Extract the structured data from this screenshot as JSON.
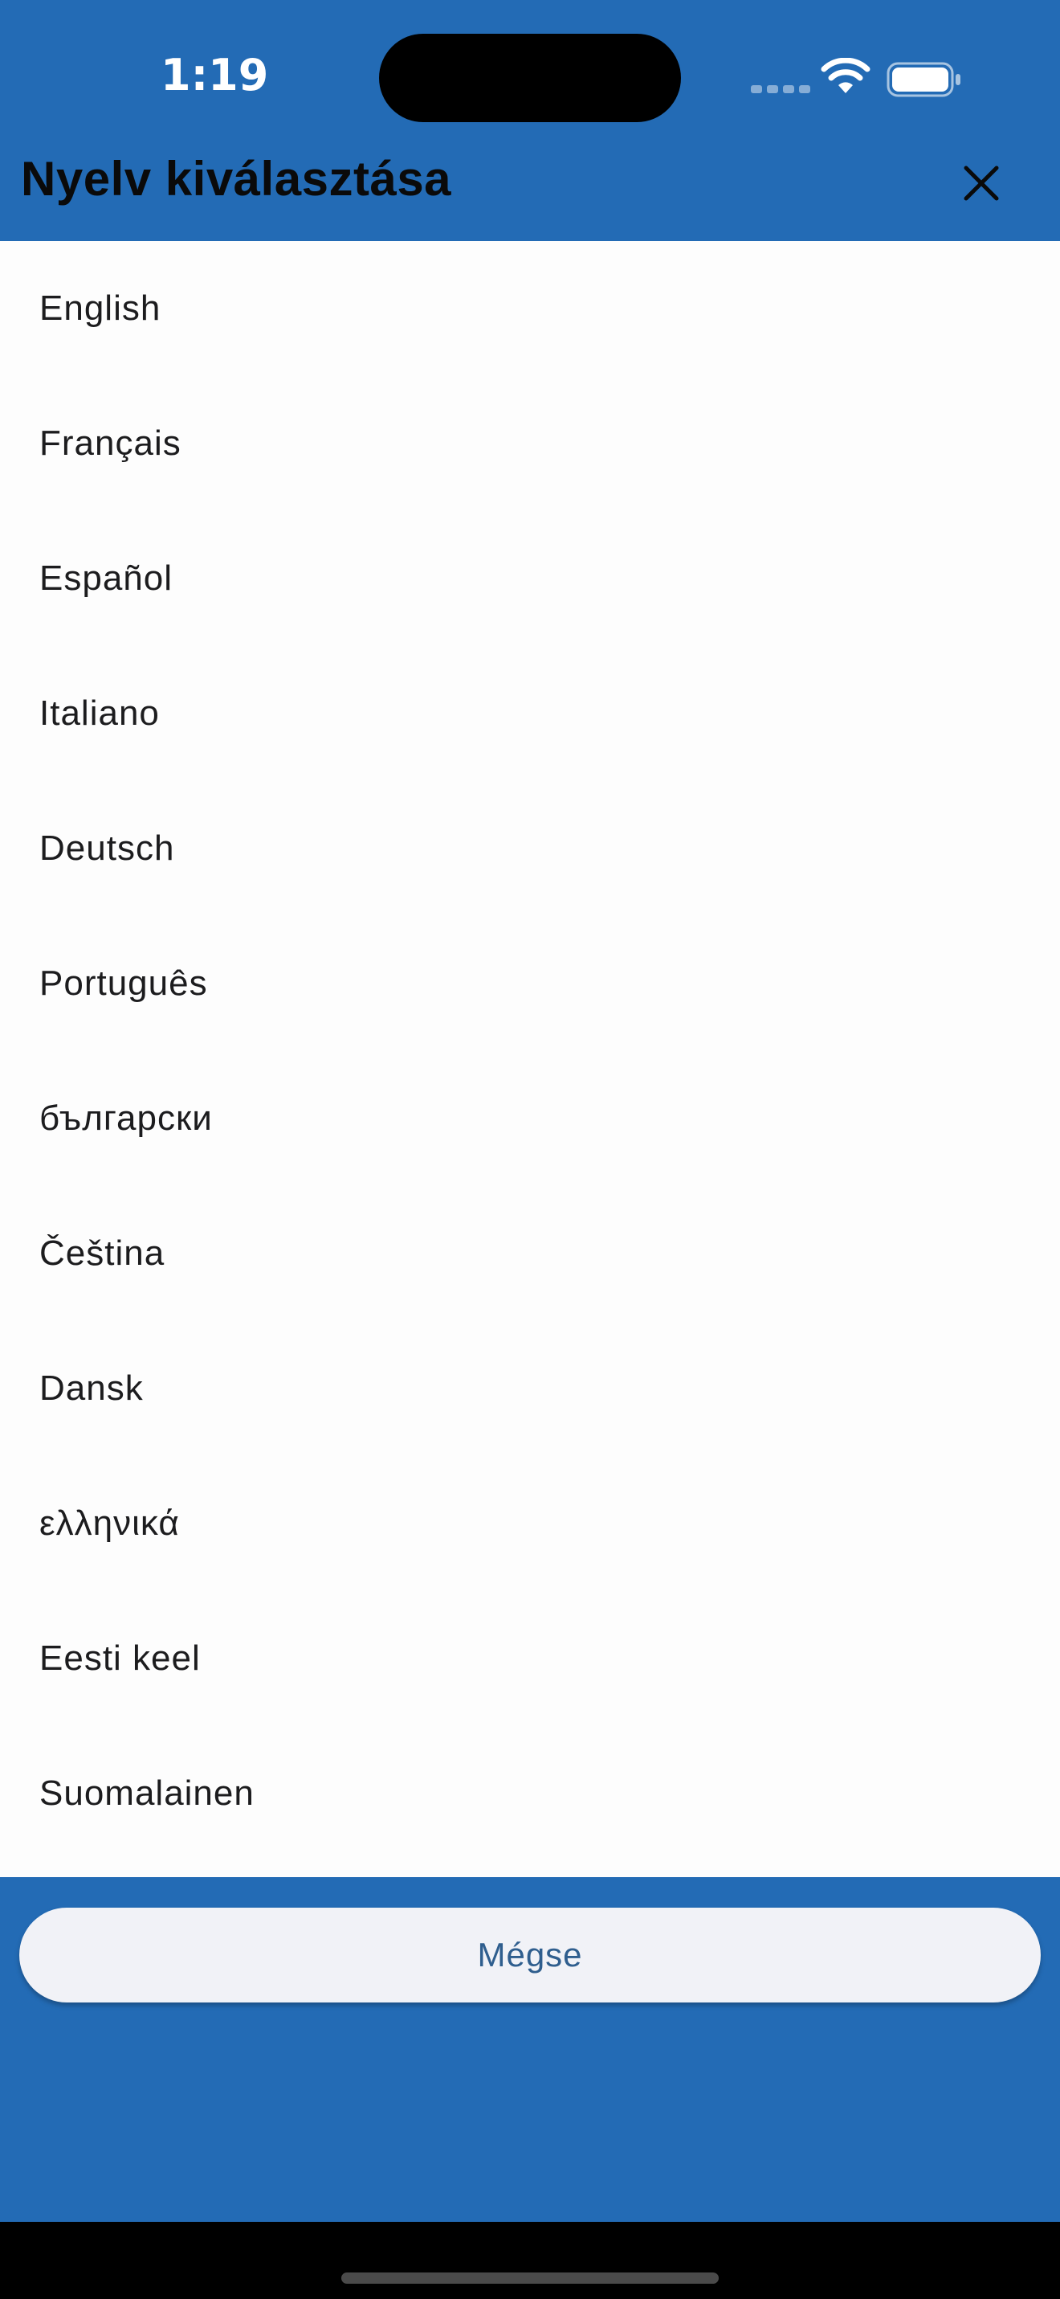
{
  "status_bar": {
    "time": "1:19",
    "icons": [
      "cellular-signal-icon",
      "wifi-icon",
      "battery-icon"
    ]
  },
  "header": {
    "title": "Nyelv kiválasztása",
    "close_icon": "close-icon"
  },
  "languages": [
    "English",
    "Français",
    "Español",
    "Italiano",
    "Deutsch",
    "Português",
    "български",
    "Čeština",
    "Dansk",
    "ελληνικά",
    "Eesti keel",
    "Suomalainen"
  ],
  "footer": {
    "cancel_label": "Mégse"
  },
  "colors": {
    "brand_blue": "#236bb5",
    "list_background": "#fdfdfd",
    "button_background": "#f1f2f7",
    "button_text": "#2f5e8e"
  }
}
